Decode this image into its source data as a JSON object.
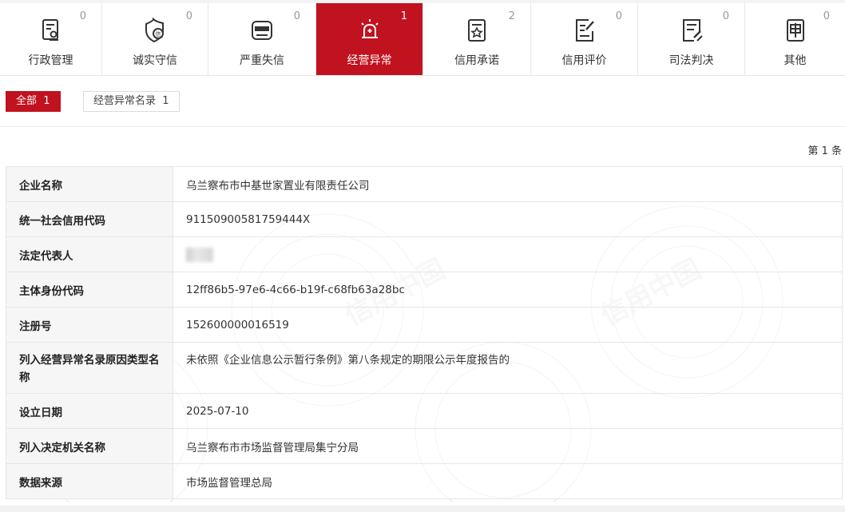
{
  "tabs": [
    {
      "label": "行政管理",
      "count": "0",
      "icon": "document-seal-icon"
    },
    {
      "label": "诚实守信",
      "count": "0",
      "icon": "shield-credit-icon"
    },
    {
      "label": "严重失信",
      "count": "0",
      "icon": "dishonest-person-icon"
    },
    {
      "label": "经营异常",
      "count": "1",
      "icon": "alarm-light-icon",
      "active": true
    },
    {
      "label": "信用承诺",
      "count": "2",
      "icon": "commitment-star-icon"
    },
    {
      "label": "信用评价",
      "count": "0",
      "icon": "evaluation-edit-icon"
    },
    {
      "label": "司法判决",
      "count": "0",
      "icon": "judgment-document-icon"
    },
    {
      "label": "其他",
      "count": "0",
      "icon": "other-document-icon"
    }
  ],
  "filters": {
    "all": {
      "label": "全部",
      "count": "1"
    },
    "sub": {
      "label": "经营异常名录",
      "count": "1"
    }
  },
  "pager": {
    "text": "第 1 条"
  },
  "record": [
    {
      "key": "企业名称",
      "value": "乌兰察布市中基世家置业有限责任公司"
    },
    {
      "key": "统一社会信用代码",
      "value": "91150900581759444X"
    },
    {
      "key": "法定代表人",
      "value": ""
    },
    {
      "key": "主体身份代码",
      "value": "12ff86b5-97e6-4c66-b19f-c68fb63a28bc"
    },
    {
      "key": "注册号",
      "value": "152600000016519"
    },
    {
      "key": "列入经营异常名录原因类型名称",
      "value": "未依照《企业信息公示暂行条例》第八条规定的期限公示年度报告的"
    },
    {
      "key": "设立日期",
      "value": "2025-07-10"
    },
    {
      "key": "列入决定机关名称",
      "value": "乌兰察布市市场监督管理局集宁分局"
    },
    {
      "key": "数据来源",
      "value": "市场监督管理总局"
    }
  ],
  "watermark": {
    "text": "信用中国"
  },
  "colors": {
    "accent": "#c1121f"
  }
}
